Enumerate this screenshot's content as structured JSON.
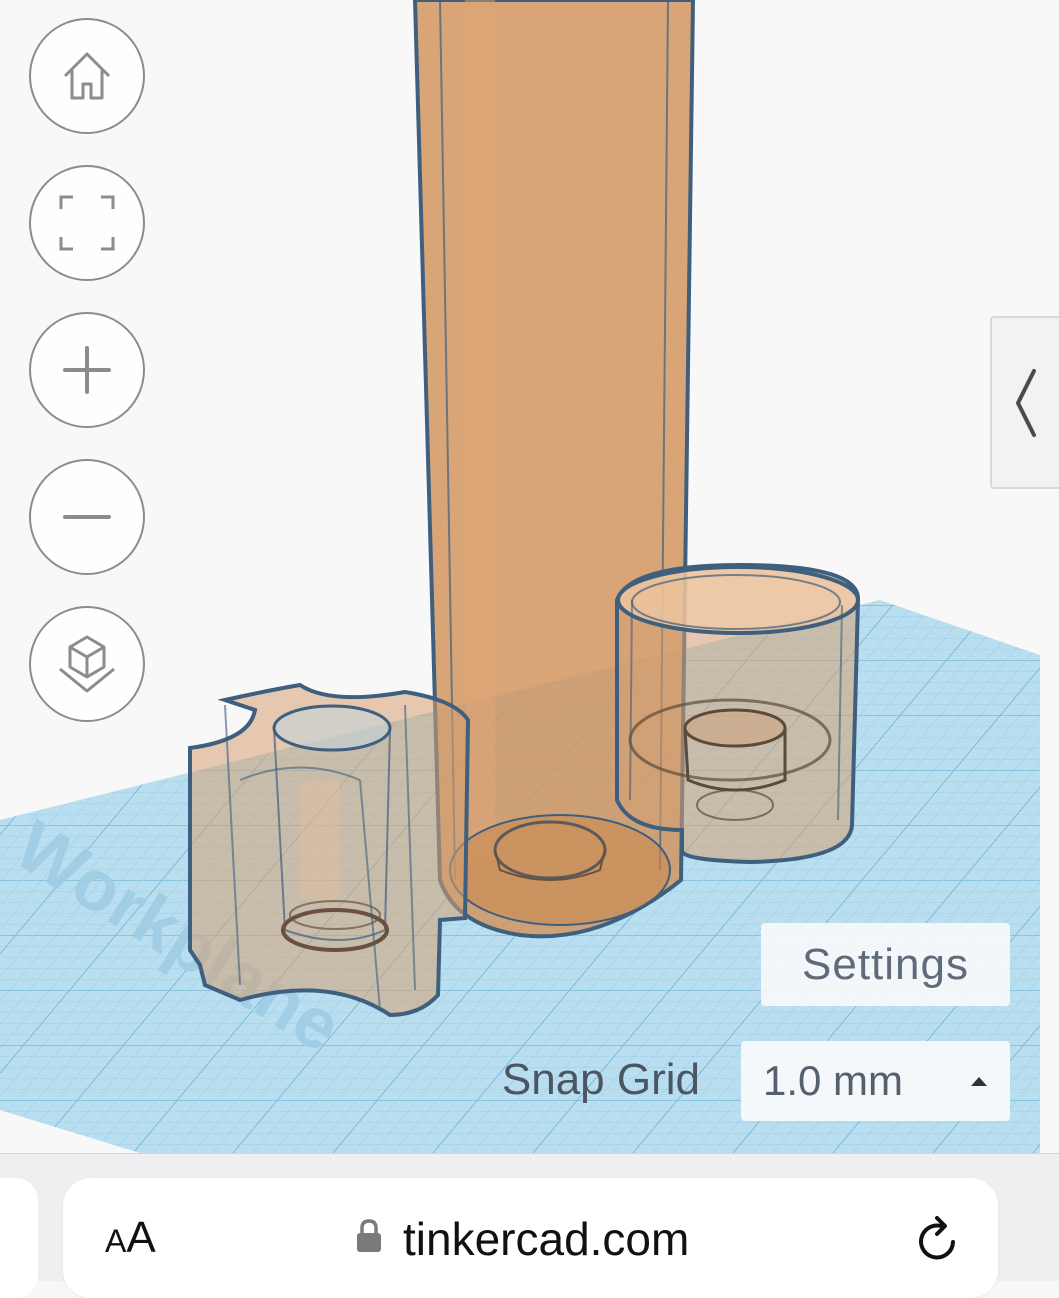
{
  "app": {
    "workplane_watermark": "Workplane",
    "accent_orange": "#d79c67",
    "grid_blue": "#a9d6ec",
    "outline_blue": "#3f5f7f"
  },
  "view_controls": {
    "items": [
      {
        "name": "home-view",
        "icon": "house-icon"
      },
      {
        "name": "fit-all",
        "icon": "fit-frame-icon"
      },
      {
        "name": "zoom-in",
        "icon": "plus-icon"
      },
      {
        "name": "zoom-out",
        "icon": "minus-icon"
      },
      {
        "name": "orthographic-view",
        "icon": "cube-icon"
      }
    ]
  },
  "side_panel": {
    "toggle_icon": "chevron-left-icon"
  },
  "settings": {
    "label": "Settings"
  },
  "snap_grid": {
    "label": "Snap Grid",
    "value": "1.0 mm",
    "arrow_icon": "caret-up-icon"
  },
  "browser": {
    "text_size_small": "A",
    "text_size_big": "A",
    "domain": "tinkercad.com",
    "lock_icon": "lock-icon",
    "reload_icon": "reload-icon"
  }
}
